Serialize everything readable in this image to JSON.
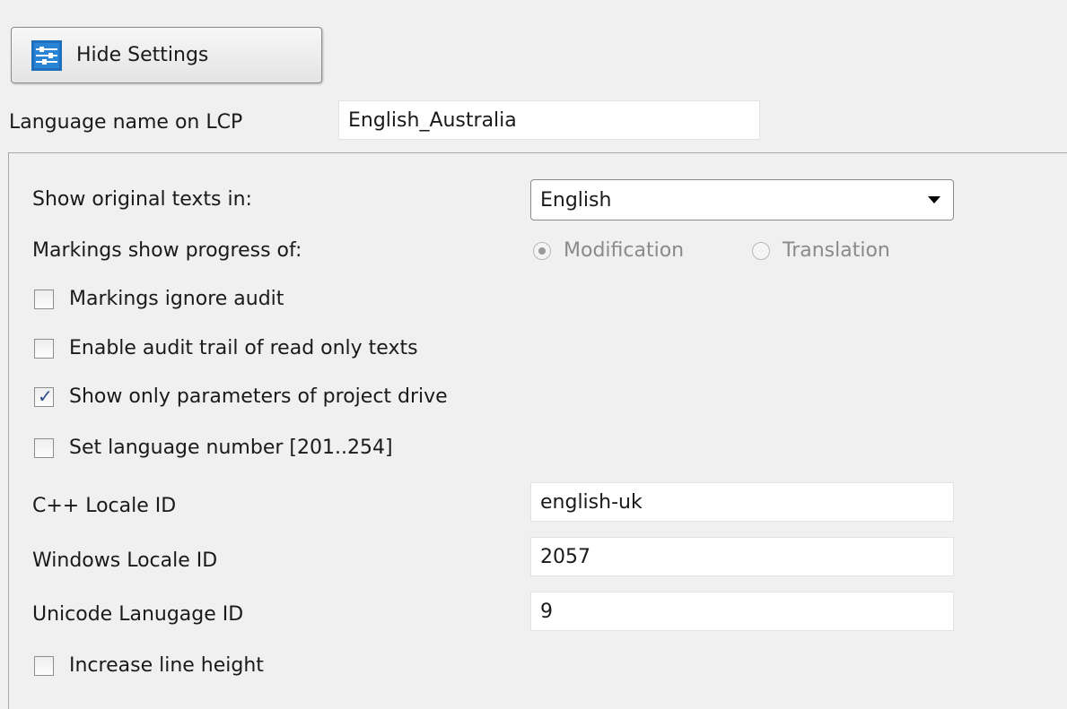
{
  "toolbar": {
    "hide_settings_label": "Hide Settings",
    "icon": "settings-sliders-icon"
  },
  "lcp": {
    "label": "Language name on LCP",
    "value": "English_Australia"
  },
  "settings": {
    "show_original_label": "Show original texts in:",
    "show_original_value": "English",
    "markings_label": "Markings show progress of:",
    "radio_modification": "Modification",
    "radio_translation": "Translation",
    "selected_radio": "Modification",
    "checkboxes": [
      {
        "label": "Markings ignore audit",
        "checked": false
      },
      {
        "label": "Enable audit trail of read only texts",
        "checked": false
      },
      {
        "label": "Show only parameters of project drive",
        "checked": true
      },
      {
        "label": "Set language number [201..254]",
        "checked": false
      },
      {
        "label": "Increase line height",
        "checked": false
      }
    ],
    "cpp_locale_label": "C++ Locale ID",
    "cpp_locale_value": "english-uk",
    "windows_locale_label": "Windows Locale ID",
    "windows_locale_value": "2057",
    "unicode_label": "Unicode Lanugage ID",
    "unicode_value": "9"
  },
  "colors": {
    "accent_icon": "#1f6fbf",
    "background": "#f0f0f0"
  }
}
